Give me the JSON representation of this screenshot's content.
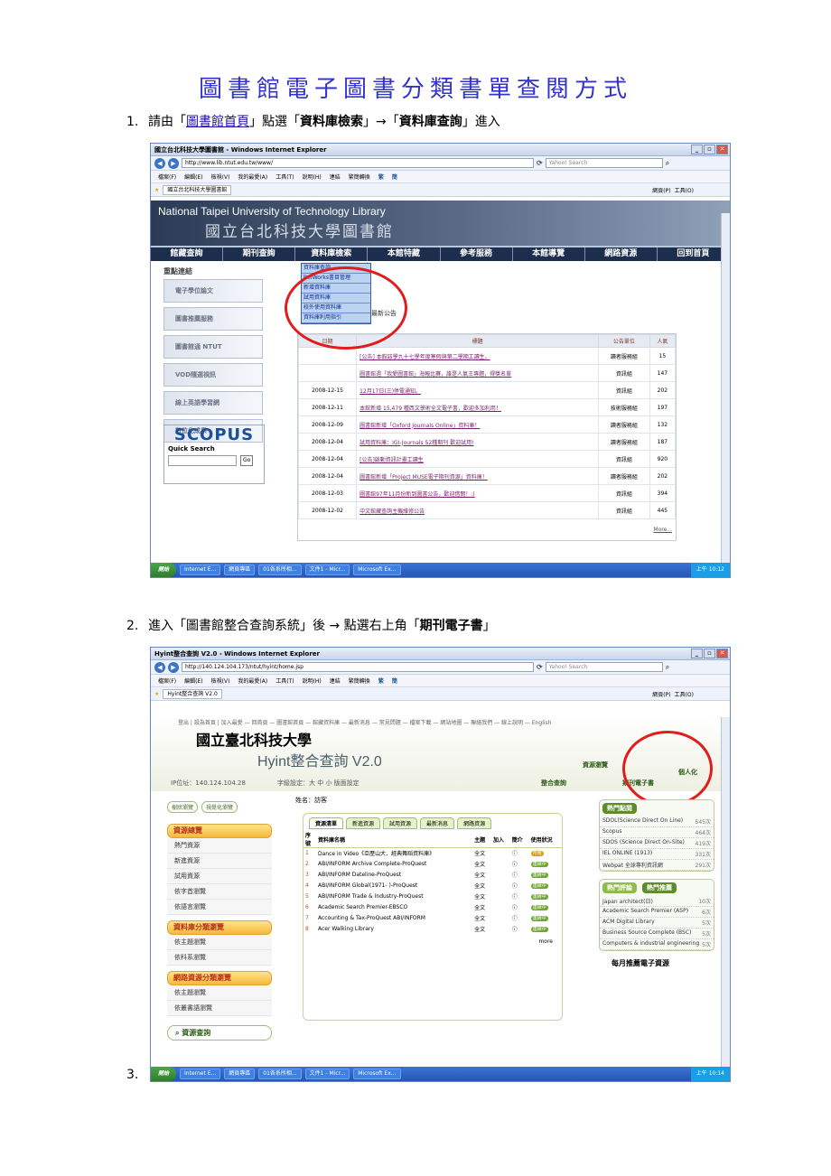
{
  "title": "圖書館電子圖書分類書單查閱方式",
  "steps": [
    {
      "num": "1.",
      "pre": "請由「",
      "link": "圖書館首頁",
      "mid1": "」點選「",
      "b1": "資料庫檢索",
      "arrow": "」→「",
      "b2": "資料庫查詢",
      "post": "」進入"
    },
    {
      "num": "2.",
      "pre": "進入「圖書館整合查詢系統」後 → 點選右上角「",
      "b1": "期刊電子書",
      "post": "」"
    },
    {
      "num": "3."
    }
  ],
  "screenshot1": {
    "window_title": "國立台北科技大學圖書館 - Windows Internet Explorer",
    "url": "http://www.lib.ntut.edu.tw/www/",
    "search_placeholder": "Yahoo! Search",
    "menu": [
      "檔案(F)",
      "編輯(E)",
      "檢視(V)",
      "我的最愛(A)",
      "工具(T)",
      "說明(H)",
      "連結",
      "繁簡轉換",
      "繁",
      "簡"
    ],
    "tab": "國立台北科技大學圖書館",
    "toolbar_right": [
      "網頁(P)",
      "工具(O)"
    ],
    "banner_en": "National Taipei University of Technology Library",
    "banner_zh": "國立台北科技大學圖書館",
    "nav": [
      "館藏查詢",
      "期刊查詢",
      "資料庫檢索",
      "本館特藏",
      "參考服務",
      "本館導覽",
      "網路資源",
      "回到首頁"
    ],
    "dropdown": [
      "資料庫查詢",
      "RefWorks書目管理",
      "新增資料庫",
      "試用資料庫",
      "校外使用資料庫",
      "資料庫利用指引"
    ],
    "side_title": "重點連結",
    "side_links": [
      "電子學位論文",
      "圖書推薦服務",
      "圖書館通 NTUT",
      "VOD隨選視訊",
      "線上英語學習網",
      "數位化成果"
    ],
    "scopus": "SCOPUS",
    "quick_search": "Quick Search",
    "go": "Go",
    "news_heading": "最新公告",
    "news_cols": [
      "日期",
      "標題",
      "公告單位",
      "人氣"
    ],
    "news": [
      [
        "",
        "[公告] 本館該學九十七學年度寒假與第二學期工讀生。",
        "讀者服務組",
        "15"
      ],
      [
        "",
        "圖書館週「我愛圖書館」海報比賽，誰是人氣王專題，得獎名單",
        "資訊組",
        "147"
      ],
      [
        "2008-12-15",
        "12月17日(三)停電通知。",
        "資訊組",
        "202"
      ],
      [
        "2008-12-11",
        "本館新增 15,479 種西文學術全文電子書，歡迎多加利用！",
        "技術服務組",
        "197"
      ],
      [
        "2008-12-09",
        "圖書館新增「Oxford Journals Online」資料庫！",
        "讀者服務組",
        "132"
      ],
      [
        "2008-12-04",
        "試用資料庫：IGI-Journals 52種期刊 歡迎試用!",
        "讀者服務組",
        "187"
      ],
      [
        "2008-12-04",
        "[公告]啟動資訊計畫工讀生",
        "資訊組",
        "920"
      ],
      [
        "2008-12-04",
        "圖書館新增「Project MUSE電子期刊資源」資料庫！",
        "讀者服務組",
        "202"
      ],
      [
        "2008-12-03",
        "圖書館97年11月份新到圖書公告，歡迎借閱！:)",
        "資訊組",
        "394"
      ],
      [
        "2008-12-02",
        "中文館藏查詢主機維修公告",
        "資訊組",
        "445"
      ]
    ],
    "more": "More...",
    "taskbar": [
      "開始",
      "Internet E...",
      "網頁專區",
      "01各系所相...",
      "文件1 - Micr...",
      "Microsoft Ex..."
    ],
    "clock": "上午 10:12"
  },
  "screenshot2": {
    "window_title": "Hyint整合查詢 V2.0 - Windows Internet Explorer",
    "url": "http://140.124.104.173/ntut/hyint/home.jsp",
    "search_placeholder": "Yahoo! Search",
    "tab": "Hyint整合查詢 V2.0",
    "top_links": "登出 | 設為首頁 | 加入最愛 — 回首頁 — 圖書館首頁 — 館藏資料庫 — 最新消息 — 常見問題 — 檔案下載 — 網站地圖 — 聯絡我們 — 線上說明 — English",
    "school": "國立臺北科技大學",
    "system": "Hyint整合查詢 V2.0",
    "ip": "IP位址：140.124.104.28",
    "font_setting": "字級設定：大 中 小 版面設定",
    "user": "姓名：訪客",
    "tab_integrated": "整合查詢",
    "tab_resources": "資源瀏覽",
    "tab_journals": "期刊電子書",
    "tab_personal": "個人化",
    "view_btns": [
      "樹狀瀏覽",
      "視覺化瀏覽"
    ],
    "left_sections": [
      {
        "title": "資源總覽",
        "items": [
          "熱門資源",
          "新進資源",
          "試用資源",
          "依字首瀏覽",
          "依語言瀏覽"
        ]
      },
      {
        "title": "資料庫分類瀏覽",
        "items": [
          "依主題瀏覽",
          "依科系瀏覽"
        ]
      },
      {
        "title": "網路資源分類瀏覽",
        "items": [
          "依主題瀏覽",
          "依叢書語瀏覽"
        ]
      }
    ],
    "resource_search": "資源查詢",
    "mid_tabs": [
      "資源清單",
      "新進資源",
      "試用資源",
      "最新消息",
      "網路資源"
    ],
    "mid_cols": [
      "序號",
      "資料庫名稱",
      "主題",
      "加入",
      "簡介",
      "使用狀況"
    ],
    "mid_rows": [
      [
        "1",
        "Dance in Video《亞歷山大．經典舞蹈資料庫》",
        "全文",
        "可用"
      ],
      [
        "2",
        "ABI/INFORM Archive Complete-ProQuest",
        "全文",
        "連線中"
      ],
      [
        "3",
        "ABI/INFORM Dateline-ProQuest",
        "全文",
        "連線中"
      ],
      [
        "4",
        "ABI/INFORM Global(1971- )-ProQuest",
        "全文",
        "連線中"
      ],
      [
        "5",
        "ABI/INFORM Trade & Industry-ProQuest",
        "全文",
        "連線中"
      ],
      [
        "6",
        "Academic Search Premier-EBSCO",
        "全文",
        "連線中"
      ],
      [
        "7",
        "Accounting & Tax-ProQuest ABI/INFORM",
        "全文",
        "連線中"
      ],
      [
        "8",
        "Acer Walking Library",
        "全文",
        "連線中"
      ]
    ],
    "mid_more": "more",
    "hot_title": "熱門點閱",
    "hot": [
      [
        "SDOL(Science Direct On Line)",
        "545次"
      ],
      [
        "Scopus",
        "464次"
      ],
      [
        "SDOS (Science Direct On-Site)",
        "419次"
      ],
      [
        "IEL ONLINE (1913)",
        "331次"
      ],
      [
        "Webpat 全球專利資訊網",
        "291次"
      ]
    ],
    "rec_tabs": [
      "熱門評論",
      "熱門推薦"
    ],
    "rec": [
      [
        "Japan architect(日)",
        "10次"
      ],
      [
        "Academic Search Premier (ASP)",
        "6次"
      ],
      [
        "ACM Digital Library",
        "5次"
      ],
      [
        "Business Source Complete (BSC)",
        "5次"
      ],
      [
        "Computers & industrial engineering",
        "5次"
      ]
    ],
    "monthly": "每月推薦電子資源",
    "taskbar": [
      "開始",
      "Internet E...",
      "網頁專區",
      "01各系所相...",
      "文件1 - Micr...",
      "Microsoft Ex..."
    ],
    "clock": "上午 10:14"
  }
}
